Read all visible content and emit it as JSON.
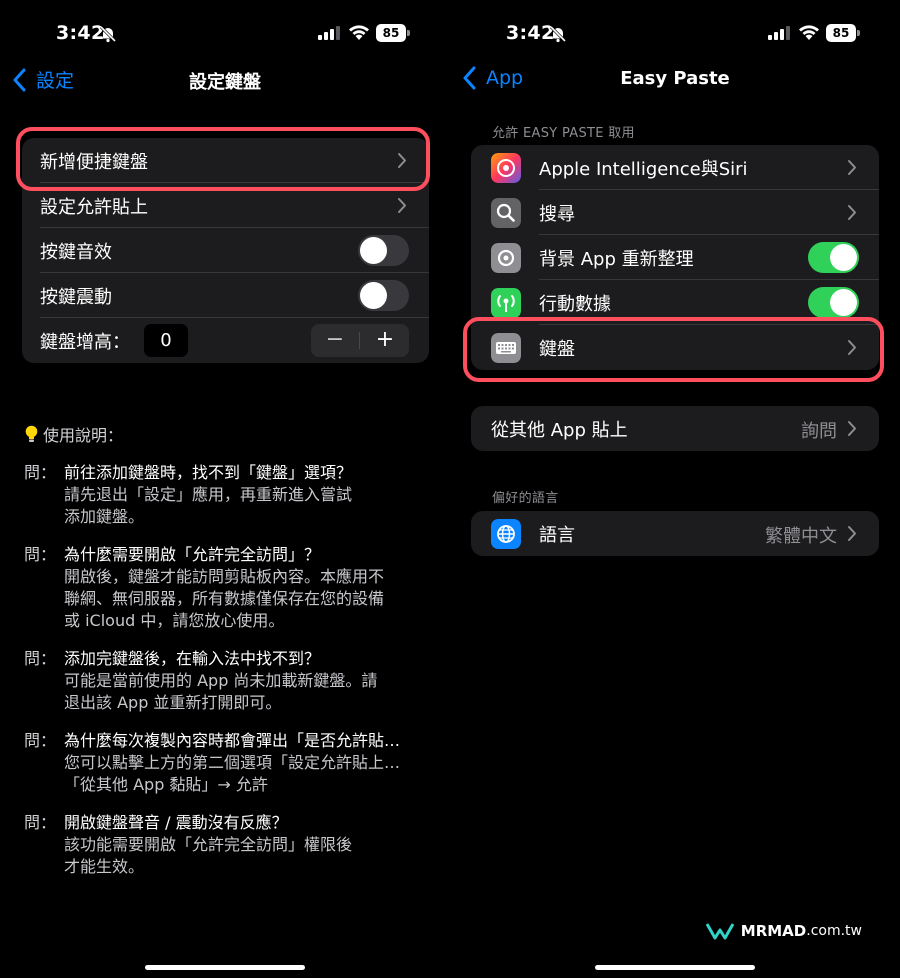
{
  "left": {
    "status": {
      "time": "3:42",
      "battery": "85"
    },
    "nav": {
      "back_label": "設定",
      "title": "設定鍵盤"
    },
    "settings": {
      "add_keyboard": "新增便捷鍵盤",
      "allow_paste": "設定允許貼上",
      "key_sound": "按鍵音效",
      "key_vibration": "按鍵震動",
      "keyboard_height_label": "鍵盤增高：",
      "keyboard_height_value": "0",
      "stepper_minus": "−",
      "stepper_plus": "+"
    },
    "help": {
      "title": "使用說明：",
      "items": [
        {
          "prefix": "問：",
          "question": "前往添加鍵盤時，找不到「鍵盤」選項？",
          "answer_lines": [
            "請先退出「設定」應用，再重新進入嘗試",
            "添加鍵盤。"
          ]
        },
        {
          "prefix": "問：",
          "question": "為什麼需要開啟「允許完全訪問」？",
          "answer_lines": [
            "開啟後，鍵盤才能訪問剪貼板內容。本應用不",
            "聯網、無伺服器，所有數據僅保存在您的設備",
            "或 iCloud 中，請您放心使用。"
          ]
        },
        {
          "prefix": "問：",
          "question": "添加完鍵盤後，在輸入法中找不到？",
          "answer_lines": [
            "可能是當前使用的 App 尚未加載新鍵盤。請",
            "退出該 App 並重新打開即可。"
          ]
        },
        {
          "prefix": "問：",
          "question": "為什麼每次複製內容時都會彈出「是否允許貼…",
          "answer_lines": [
            "您可以點擊上方的第二個選項「設定允許貼上…",
            "「從其他 App 黏貼」→ 允許"
          ]
        },
        {
          "prefix": "問：",
          "question": "開啟鍵盤聲音 / 震動沒有反應？",
          "answer_lines": [
            "該功能需要開啟「允許完全訪問」權限後",
            "才能生效。"
          ]
        }
      ]
    }
  },
  "right": {
    "status": {
      "time": "3:42",
      "battery": "85"
    },
    "nav": {
      "back_label": "App",
      "title": "Easy Paste"
    },
    "section_allow": "允許 EASY PASTE 取用",
    "rows": {
      "siri": "Apple Intelligence與Siri",
      "search": "搜尋",
      "background_refresh": "背景 App 重新整理",
      "cellular": "行動數據",
      "keyboard": "鍵盤"
    },
    "paste_from_apps": {
      "label": "從其他 App 貼上",
      "value": "詢問"
    },
    "section_language": "偏好的語言",
    "language": {
      "label": "語言",
      "value": "繁體中文"
    }
  },
  "watermark": {
    "brand": "MRMAD",
    "domain": ".com.tw"
  },
  "toggles": {
    "key_sound": false,
    "key_vibration": false,
    "background_refresh": true,
    "cellular": true
  },
  "colors": {
    "accent": "#0a84ff",
    "highlight": "#ff4f5e",
    "toggle_on": "#30d158"
  }
}
